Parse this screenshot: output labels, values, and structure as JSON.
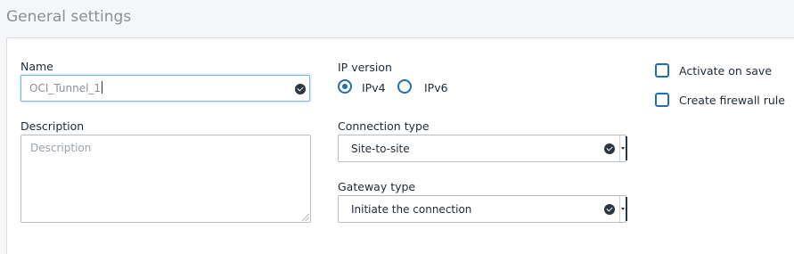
{
  "section": {
    "title": "General settings"
  },
  "name": {
    "label": "Name",
    "value": "OCI_Tunnel_1"
  },
  "description": {
    "label": "Description",
    "placeholder": "Description"
  },
  "ip_version": {
    "label": "IP version",
    "options": [
      {
        "label": "IPv4",
        "checked": true
      },
      {
        "label": "IPv6",
        "checked": false
      }
    ]
  },
  "connection_type": {
    "label": "Connection type",
    "value": "Site-to-site"
  },
  "gateway_type": {
    "label": "Gateway type",
    "value": "Initiate the connection"
  },
  "options": {
    "activate_on_save": {
      "label": "Activate on save",
      "checked": false
    },
    "create_firewall_rule": {
      "label": "Create firewall rule",
      "checked": false
    }
  },
  "colors": {
    "accent": "#1f6fb5",
    "focus_border": "#7fb3e0",
    "title_gray": "#8a9097"
  }
}
